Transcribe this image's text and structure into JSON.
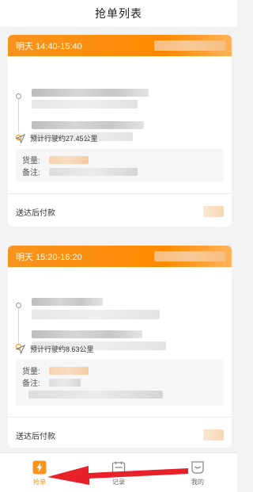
{
  "header": {
    "title": "抢单列表"
  },
  "orders": [
    {
      "time_label": "明天 14:40-15:40",
      "distance": "预计行驶约27.45公里",
      "cargo_label": "货量:",
      "note_label": "备注:",
      "payment": "送达后付款"
    },
    {
      "time_label": "明天 15:20-16:20",
      "distance": "预计行驶约8.63公里",
      "cargo_label": "货量:",
      "note_label": "备注:",
      "payment": "送达后付款"
    }
  ],
  "tabs": [
    {
      "label": "抢单",
      "icon": "lightning-icon",
      "active": true
    },
    {
      "label": "记录",
      "icon": "calendar-icon",
      "active": false
    },
    {
      "label": "我的",
      "icon": "smile-face-icon",
      "active": false
    }
  ],
  "colors": {
    "accent": "#f7931e",
    "annotation": "#e8202a"
  }
}
